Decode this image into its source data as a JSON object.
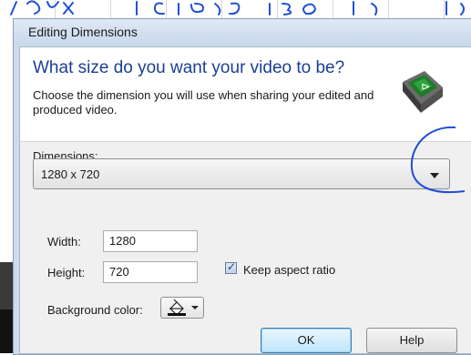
{
  "dialog": {
    "title": "Editing Dimensions",
    "headline": "What size do you want your video to be?",
    "description": "Choose the dimension you will use when sharing your edited and produced video.",
    "dimensions_label": "Dimensions:",
    "dimensions_value": "1280 x 720",
    "width_label": "Width:",
    "width_value": "1280",
    "height_label": "Height:",
    "height_value": "720",
    "keep_aspect_label": "Keep aspect ratio",
    "keep_aspect_checked": true,
    "background_color_label": "Background color:",
    "ok_label": "OK",
    "help_label": "Help"
  },
  "icons": {
    "app": "video-editor-icon",
    "color_picker": "paint-bucket-icon",
    "dropdown": "chevron-down-icon"
  },
  "colors": {
    "headline": "#1b3f94",
    "ink": "#1f4fd6"
  }
}
